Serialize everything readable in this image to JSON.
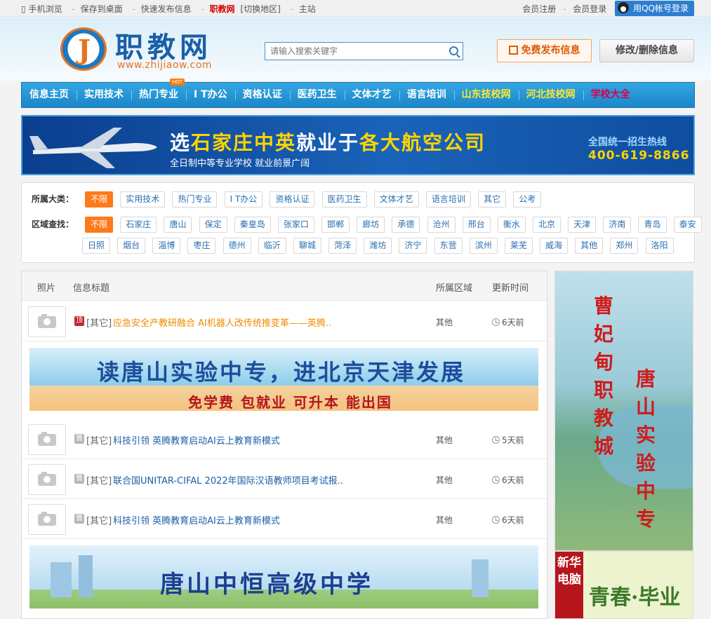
{
  "topbar": {
    "left": [
      "手机浏览",
      "保存到桌面",
      "快速发布信息"
    ],
    "site": "职教网",
    "switch": "[切换地区]",
    "station": "主站",
    "register": "会员注册",
    "login": "会员登录",
    "qq_login": "用QQ帐号登录"
  },
  "header": {
    "logo_text": "职教网",
    "logo_url": "www.zhijiaow.com",
    "search_placeholder": "请输入搜索关键字",
    "post_button": "免费发布信息",
    "edit_button": "修改/删除信息"
  },
  "nav": {
    "items": [
      "信息主页",
      "实用技术",
      "热门专业",
      "I T办公",
      "资格认证",
      "医药卫生",
      "文体才艺",
      "语言培训",
      "山东技校网",
      "河北技校网",
      "学校大全"
    ],
    "hot_badge": "HOT"
  },
  "banner1": {
    "title_a": "选",
    "title_b": "石家庄中英",
    "title_c": "就业于",
    "title_d": "各大航空公司",
    "sub": "全日制中等专业学校  就业前景广阔",
    "hotline_label": "全国统一招生热线",
    "hotline": "400-619-8866"
  },
  "filter": {
    "category_label": "所属大类：",
    "categories": [
      "不限",
      "实用技术",
      "热门专业",
      "I T办公",
      "资格认证",
      "医药卫生",
      "文体才艺",
      "语言培训",
      "其它",
      "公考"
    ],
    "region_label": "区域查找：",
    "regions_row1": [
      "不限",
      "石家庄",
      "唐山",
      "保定",
      "秦皇岛",
      "张家口",
      "邯郸",
      "廊坊",
      "承德",
      "沧州",
      "邢台",
      "衡水",
      "北京",
      "天津",
      "济南",
      "青岛",
      "泰安"
    ],
    "regions_row2": [
      "日照",
      "烟台",
      "淄博",
      "枣庄",
      "德州",
      "临沂",
      "聊城",
      "菏泽",
      "潍坊",
      "济宁",
      "东营",
      "滨州",
      "莱芜",
      "威海",
      "其他",
      "郑州",
      "洛阳"
    ]
  },
  "table": {
    "headers": {
      "photo": "照片",
      "title": "信息标题",
      "region": "所属区域",
      "time": "更新时间"
    },
    "rows": [
      {
        "badge": "顶",
        "cat": "[其它]",
        "title": "应急安全产教研融合 AI机器人改传统推变革——英腾..",
        "region": "其他",
        "time": "6天前"
      },
      {
        "badge": "普",
        "cat": "[其它]",
        "title": "科技引领 英腾教育启动AI云上教育新模式",
        "region": "其他",
        "time": "5天前"
      },
      {
        "badge": "普",
        "cat": "[其它]",
        "title": "联合国UNITAR-CIFAL 2022年国际汉语教师项目考试报..",
        "region": "其他",
        "time": "6天前"
      },
      {
        "badge": "普",
        "cat": "[其它]",
        "title": "科技引领 英腾教育启动AI云上教育新模式",
        "region": "其他",
        "time": "6天前"
      }
    ]
  },
  "ads": {
    "mid_title": "读唐山实验中专，进北京天津发展",
    "mid_sub": "免学费 包就业 可升本 能出国",
    "bottom_title": "唐山中恒高级中学",
    "side1_left": "曹妃甸职教城",
    "side1_right": "唐山实验中专",
    "side2_label": "新华电脑",
    "side2_slogan": "青春·毕业"
  },
  "colors": {
    "accent": "#ff7a1a",
    "nav": "#1a86c8",
    "link": "#1a5fa8"
  }
}
